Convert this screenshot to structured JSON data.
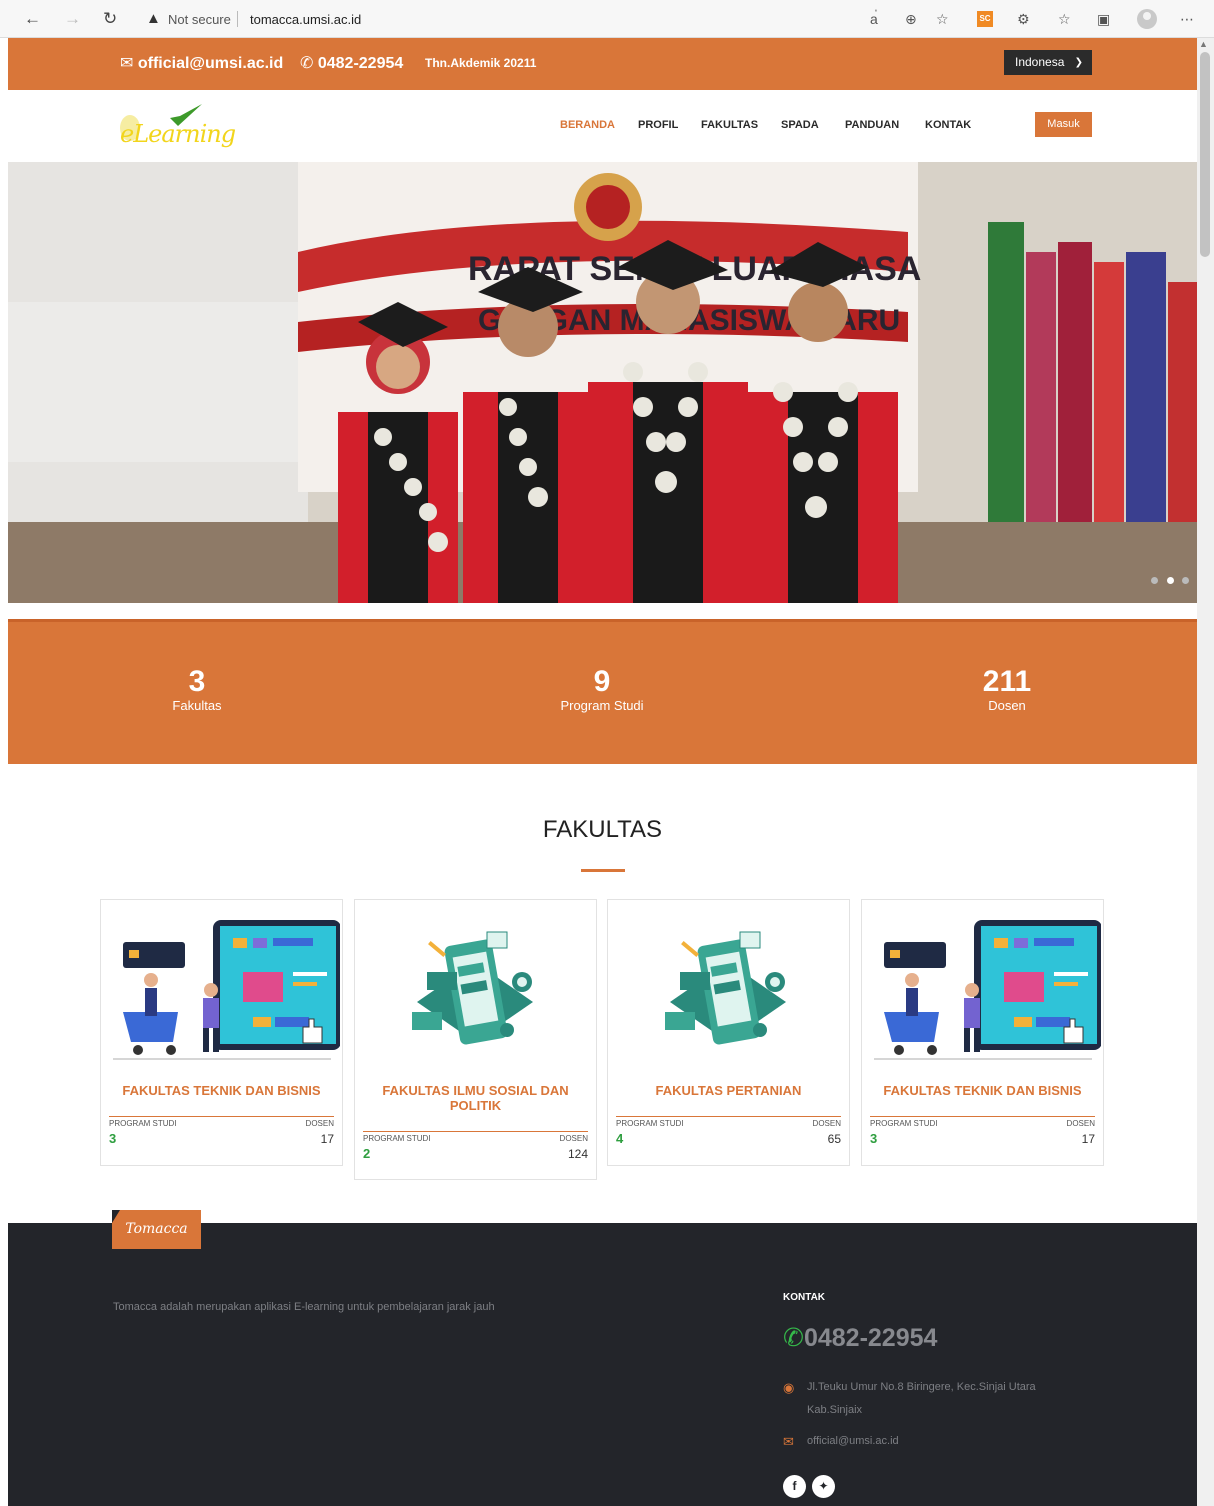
{
  "browser": {
    "security_label": "Not secure",
    "url": "tomacca.umsi.ac.id",
    "extension_label": "SC"
  },
  "topbar": {
    "email": "official@umsi.ac.id",
    "phone": "0482-22954",
    "academic_year": "Thn.Akdemik 20211",
    "language": "Indonesa"
  },
  "nav": {
    "logo_text": "eLearning",
    "items": [
      "BERANDA",
      "PROFIL",
      "FAKULTAS",
      "SPADA",
      "PANDUAN",
      "KONTAK"
    ],
    "active_index": 0,
    "login_label": "Masuk"
  },
  "hero": {
    "slide_count": 3,
    "active_slide": 2
  },
  "stats": [
    {
      "value": "3",
      "label": "Fakultas"
    },
    {
      "value": "9",
      "label": "Program Studi"
    },
    {
      "value": "211",
      "label": "Dosen"
    }
  ],
  "fakultas": {
    "title": "FAKULTAS",
    "program_label": "PROGRAM STUDI",
    "dosen_label": "DOSEN",
    "cards": [
      {
        "name": "FAKULTAS TEKNIK DAN BISNIS",
        "program_studi": "3",
        "dosen": "17",
        "illustration": "online-shopping-illustration"
      },
      {
        "name": "FAKULTAS ILMU SOSIAL DAN POLITIK",
        "program_studi": "2",
        "dosen": "124",
        "illustration": "mobile-app-illustration"
      },
      {
        "name": "FAKULTAS PERTANIAN",
        "program_studi": "4",
        "dosen": "65",
        "illustration": "mobile-app-illustration"
      },
      {
        "name": "FAKULTAS TEKNIK DAN BISNIS",
        "program_studi": "3",
        "dosen": "17",
        "illustration": "online-shopping-illustration"
      }
    ]
  },
  "footer": {
    "brand": "Tomacca",
    "description": "Tomacca adalah merupakan aplikasi E-learning untuk pembelajaran jarak jauh",
    "kontak_title": "KONTAK",
    "phone": "0482-22954",
    "address_line1": "Jl.Teuku Umur No.8 Biringere, Kec.Sinjai Utara",
    "address_line2": "Kab.Sinjaix",
    "email": "official@umsi.ac.id",
    "social": [
      "facebook",
      "twitter"
    ]
  },
  "colors": {
    "accent": "#d97639",
    "footer_bg": "#23252a",
    "count_green": "#2e9e3f"
  }
}
